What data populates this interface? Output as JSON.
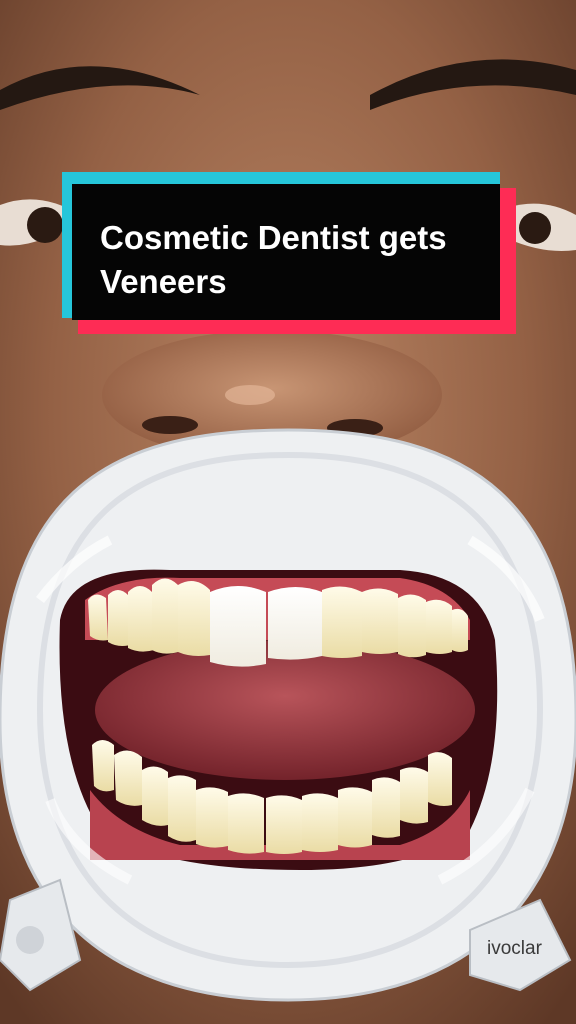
{
  "caption": {
    "text": "Cosmetic Dentist gets Veneers"
  },
  "retractor_brand": "ivoclar",
  "colors": {
    "caption_bg": "#050505",
    "caption_text": "#ffffff",
    "accent_cyan": "#26c6da",
    "accent_red": "#fe2c55"
  }
}
